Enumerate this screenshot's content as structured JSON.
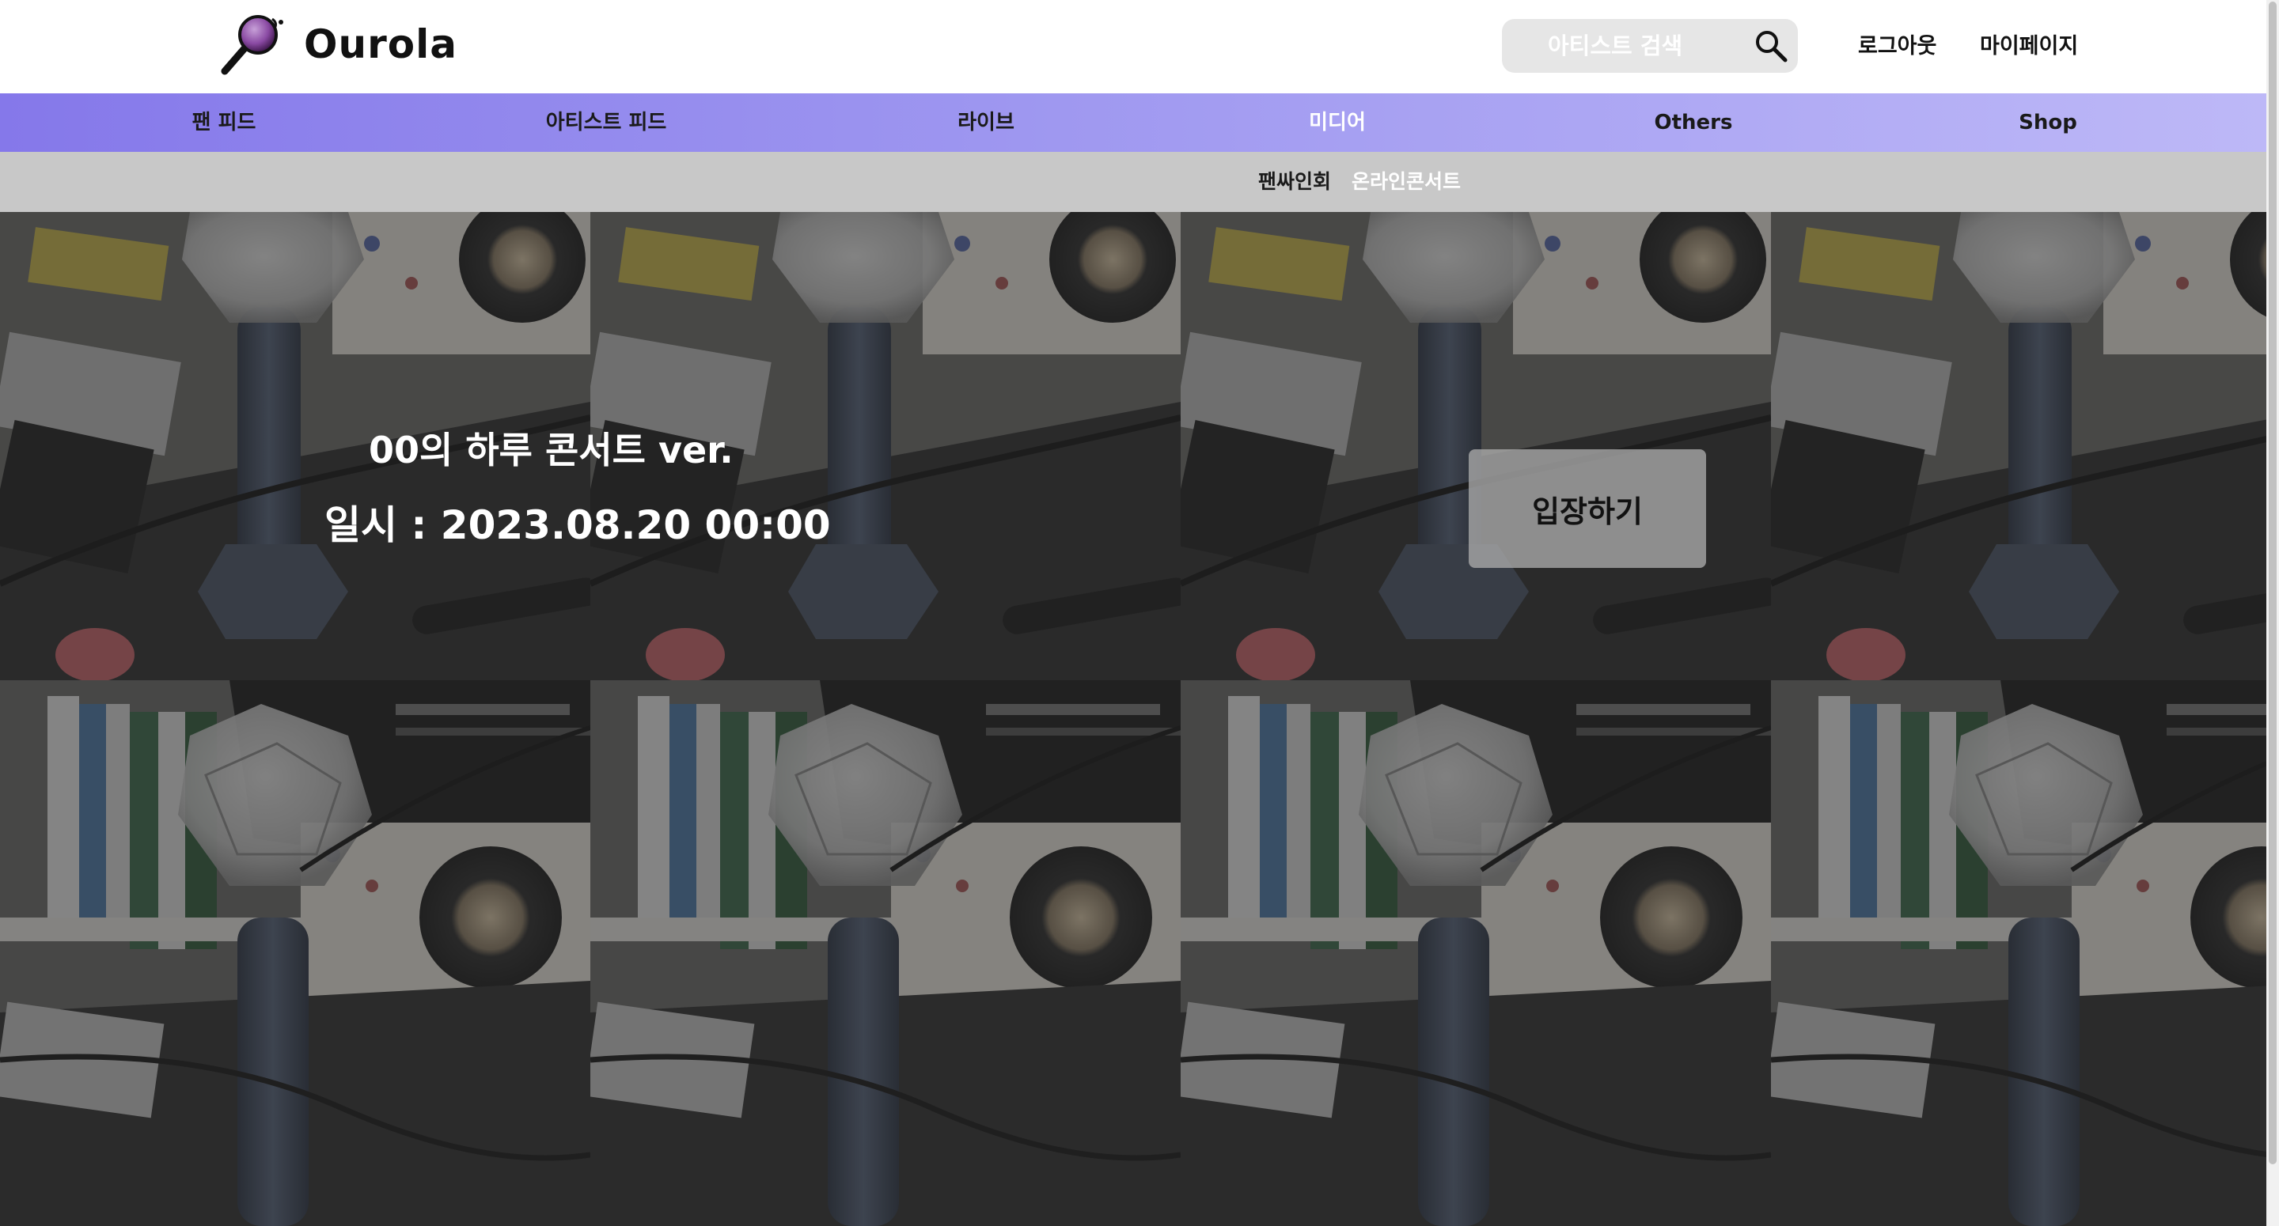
{
  "brand": {
    "name": "Ourola",
    "icon": "microphone-icon"
  },
  "search": {
    "placeholder": "아티스트 검색",
    "icon": "search-icon"
  },
  "header_links": {
    "logout": "로그아웃",
    "mypage": "마이페이지"
  },
  "main_nav": {
    "items": [
      {
        "label": "팬 피드"
      },
      {
        "label": "아티스트 피드"
      },
      {
        "label": "라이브"
      },
      {
        "label": "미디어",
        "active": true
      },
      {
        "label": "Others"
      },
      {
        "label": "Shop"
      }
    ]
  },
  "sub_nav": {
    "items": [
      {
        "label": "팬싸인회"
      },
      {
        "label": "온라인콘서트",
        "active": true
      }
    ]
  },
  "concert": {
    "title": "00의 하루 콘서트 ver.",
    "date_line": "일시 : 2023.08.20 00:00",
    "enter_label": "입장하기"
  },
  "colors": {
    "nav_gradient_start": "#8578ea",
    "nav_gradient_end": "#bdb8f7",
    "sub_nav_bg": "#c8c8c8",
    "search_bg": "#e6e6e6"
  }
}
